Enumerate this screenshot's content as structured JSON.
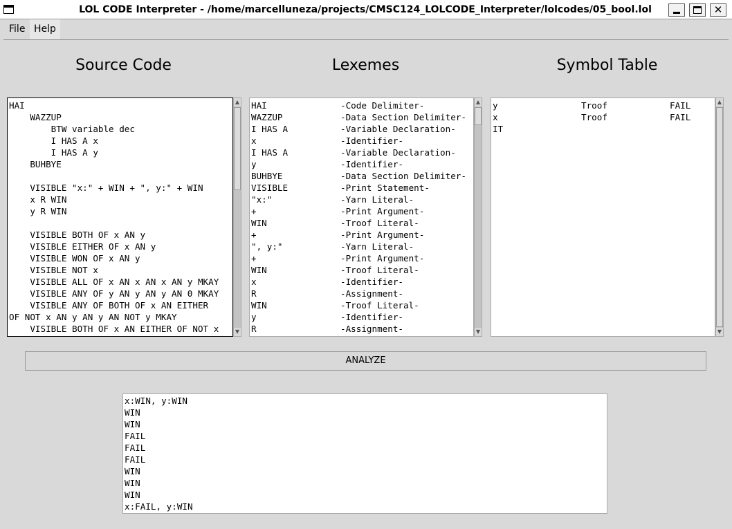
{
  "window": {
    "title": "LOL CODE Interpreter - /home/marcelluneza/projects/CMSC124_LOLCODE_Interpreter/lolcodes/05_bool.lol",
    "close_glyph": "✕"
  },
  "menu": {
    "file": "File",
    "help": "Help"
  },
  "headings": {
    "source": "Source Code",
    "lexemes": "Lexemes",
    "symbols": "Symbol Table"
  },
  "source_lines": [
    "HAI",
    "    WAZZUP",
    "        BTW variable dec",
    "        I HAS A x",
    "        I HAS A y",
    "    BUHBYE",
    "",
    "    VISIBLE \"x:\" + WIN + \", y:\" + WIN",
    "    x R WIN",
    "    y R WIN",
    "",
    "    VISIBLE BOTH OF x AN y",
    "    VISIBLE EITHER OF x AN y",
    "    VISIBLE WON OF x AN y",
    "    VISIBLE NOT x",
    "    VISIBLE ALL OF x AN x AN x AN y MKAY",
    "    VISIBLE ANY OF y AN y AN y AN 0 MKAY",
    "    VISIBLE ANY OF BOTH OF x AN EITHER",
    "OF NOT x AN y AN y AN NOT y MKAY",
    "    VISIBLE BOTH OF x AN EITHER OF NOT x"
  ],
  "lexemes": [
    {
      "lexeme": "HAI",
      "type": "-Code Delimiter-"
    },
    {
      "lexeme": "WAZZUP",
      "type": "-Data Section Delimiter-"
    },
    {
      "lexeme": "I HAS A",
      "type": "-Variable Declaration-"
    },
    {
      "lexeme": "x",
      "type": "-Identifier-"
    },
    {
      "lexeme": "I HAS A",
      "type": "-Variable Declaration-"
    },
    {
      "lexeme": "y",
      "type": "-Identifier-"
    },
    {
      "lexeme": "BUHBYE",
      "type": "-Data Section Delimiter-"
    },
    {
      "lexeme": "VISIBLE",
      "type": "-Print Statement-"
    },
    {
      "lexeme": "\"x:\"",
      "type": "-Yarn Literal-"
    },
    {
      "lexeme": "+",
      "type": "-Print Argument-"
    },
    {
      "lexeme": "WIN",
      "type": "-Troof Literal-"
    },
    {
      "lexeme": "+",
      "type": "-Print Argument-"
    },
    {
      "lexeme": "\", y:\"",
      "type": "-Yarn Literal-"
    },
    {
      "lexeme": "+",
      "type": "-Print Argument-"
    },
    {
      "lexeme": "WIN",
      "type": "-Troof Literal-"
    },
    {
      "lexeme": "x",
      "type": "-Identifier-"
    },
    {
      "lexeme": "R",
      "type": "-Assignment-"
    },
    {
      "lexeme": "WIN",
      "type": "-Troof Literal-"
    },
    {
      "lexeme": "y",
      "type": "-Identifier-"
    },
    {
      "lexeme": "R",
      "type": "-Assignment-"
    }
  ],
  "symbols": [
    {
      "name": "y",
      "type": "Troof",
      "value": "FAIL"
    },
    {
      "name": "x",
      "type": "Troof",
      "value": "FAIL"
    },
    {
      "name": "IT",
      "type": "",
      "value": ""
    }
  ],
  "analyze_label": "ANALYZE",
  "output_lines": [
    "x:WIN, y:WIN",
    "WIN",
    "WIN",
    "FAIL",
    "FAIL",
    "FAIL",
    "WIN",
    "WIN",
    "WIN",
    "x:FAIL, y:WIN"
  ]
}
